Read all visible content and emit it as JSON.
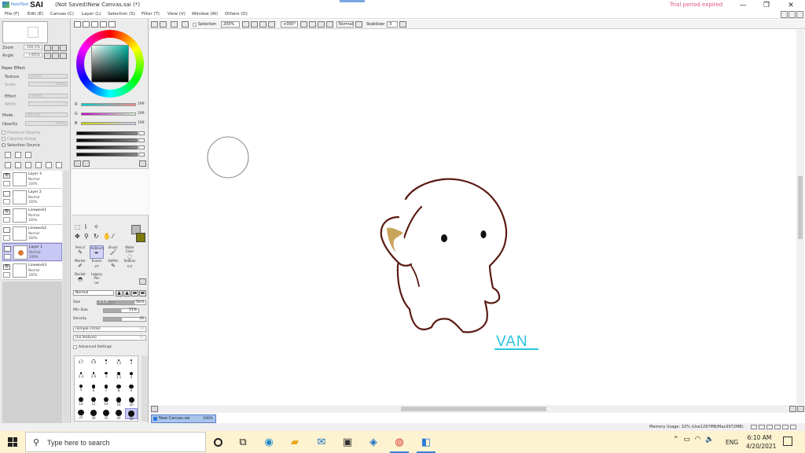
{
  "titlebar": {
    "brand": "PaintTool",
    "app": "SAI",
    "document": "(Not Saved)New Canvas.sai (*)",
    "trial": "Trial period expired",
    "minimize": "—",
    "maximize": "❐",
    "close": "✕"
  },
  "menu": [
    "File (F)",
    "Edit (E)",
    "Canvas (C)",
    "Layer (L)",
    "Selection (S)",
    "Filter (T)",
    "View (V)",
    "Window (W)",
    "Others (O)"
  ],
  "navigator": {
    "zoom_label": "Zoom",
    "zoom_value": "200.0%",
    "angle_label": "Angle",
    "angle_value": "+000$"
  },
  "paper_effect": {
    "heading": "Paper Effect",
    "texture_label": "Texture",
    "texture_value": "(none)",
    "scale_label": "Scale",
    "scale_value": "100%",
    "effect_label": "Effect",
    "effect_value": "(none)",
    "width_label": "Width",
    "width_value": "1"
  },
  "layer_props": {
    "mode_label": "Mode",
    "mode_value": "Normal",
    "opacity_label": "Opacity",
    "opacity_value": "100%",
    "preserve_opacity": "Preserve Opacity",
    "clipping_group": "Clipping Group",
    "selection_source": "Selection Source"
  },
  "layers": [
    {
      "name": "Layer 3",
      "mode": "Normal",
      "opacity": "100%",
      "visible": true,
      "selected": false
    },
    {
      "name": "Layer 2",
      "mode": "Normal",
      "opacity": "100%",
      "visible": false,
      "selected": false
    },
    {
      "name": "Linework1",
      "mode": "Normal",
      "opacity": "100%",
      "visible": true,
      "selected": false
    },
    {
      "name": "Linework2",
      "mode": "Normal",
      "opacity": "100%",
      "visible": false,
      "selected": false
    },
    {
      "name": "Layer 1",
      "mode": "Normal",
      "opacity": "100%",
      "visible": false,
      "selected": true
    },
    {
      "name": "Linework3",
      "mode": "Normal",
      "opacity": "100%",
      "visible": true,
      "selected": false
    }
  ],
  "color": {
    "r_label": "R",
    "r_value": "199",
    "g_label": "G",
    "g_value": "199",
    "b_label": "B",
    "b_value": "199",
    "fg": "#b8b8b8",
    "bg": "#7b7b0a"
  },
  "tools": {
    "row1": [
      {
        "label": "Pencil",
        "icon": "pencil-icon",
        "glyph": "✎"
      },
      {
        "label": "AirBrush",
        "icon": "airbrush-icon",
        "glyph": "✒"
      },
      {
        "label": "Brush",
        "icon": "brush-icon",
        "glyph": "🖌"
      },
      {
        "label": "Water Color",
        "icon": "watercolor-icon",
        "glyph": "◌"
      }
    ],
    "row2": [
      {
        "label": "Marker",
        "icon": "marker-icon",
        "glyph": "✐"
      },
      {
        "label": "Eraser",
        "icon": "eraser-icon",
        "glyph": "▱"
      },
      {
        "label": "SelPen",
        "icon": "selpen-icon",
        "glyph": "✎"
      },
      {
        "label": "SelEras",
        "icon": "seleras-icon",
        "glyph": "▭"
      }
    ],
    "row3": [
      {
        "label": "Bucket",
        "icon": "bucket-icon",
        "glyph": "◓"
      },
      {
        "label": "Legacy Pen",
        "icon": "legacy-pen-icon",
        "glyph": "✑"
      }
    ]
  },
  "brush_props": {
    "blend_mode": "Normal",
    "size_label": "Size",
    "size_mult": "x 1.0",
    "size_value": "50.0",
    "min_size_label": "Min Size",
    "min_size_value": "51%",
    "density_label": "Density",
    "density_value": "43",
    "shape": "(simple circle)",
    "shape_value": "50",
    "texture": "(no texture)",
    "texture_value": "95",
    "advanced": "Advanced Settings"
  },
  "brush_sizes": [
    "0.7",
    "0.8",
    "1",
    "1.5",
    "2",
    "2.3",
    "2.6",
    "3",
    "3.5",
    "4",
    "5",
    "6",
    "7",
    "8",
    "9",
    "10",
    "12",
    "14",
    "16",
    "20",
    "25",
    "30",
    "35",
    "40",
    "50"
  ],
  "canvas_toolbar": {
    "selection_label": "Selection",
    "zoom": "200%",
    "angle": "+000°",
    "blend": "Normal",
    "stabilizer_label": "Stabilizer",
    "stabilizer_value": "3"
  },
  "drawing": {
    "signature": "VAN",
    "outline_color": "#5a1a14",
    "signature_color": "#29c4e0",
    "accent_color": "#c9a45b"
  },
  "doc_tab": {
    "name": "New Canvas.sai",
    "zoom": "200%"
  },
  "status": {
    "memory": "Memory Usage: 32% (Use1297MB/Max3972MB)"
  },
  "taskbar": {
    "search_placeholder": "Type here to search",
    "lang": "ENG",
    "time": "6:10 AM",
    "date": "4/20/2021"
  }
}
